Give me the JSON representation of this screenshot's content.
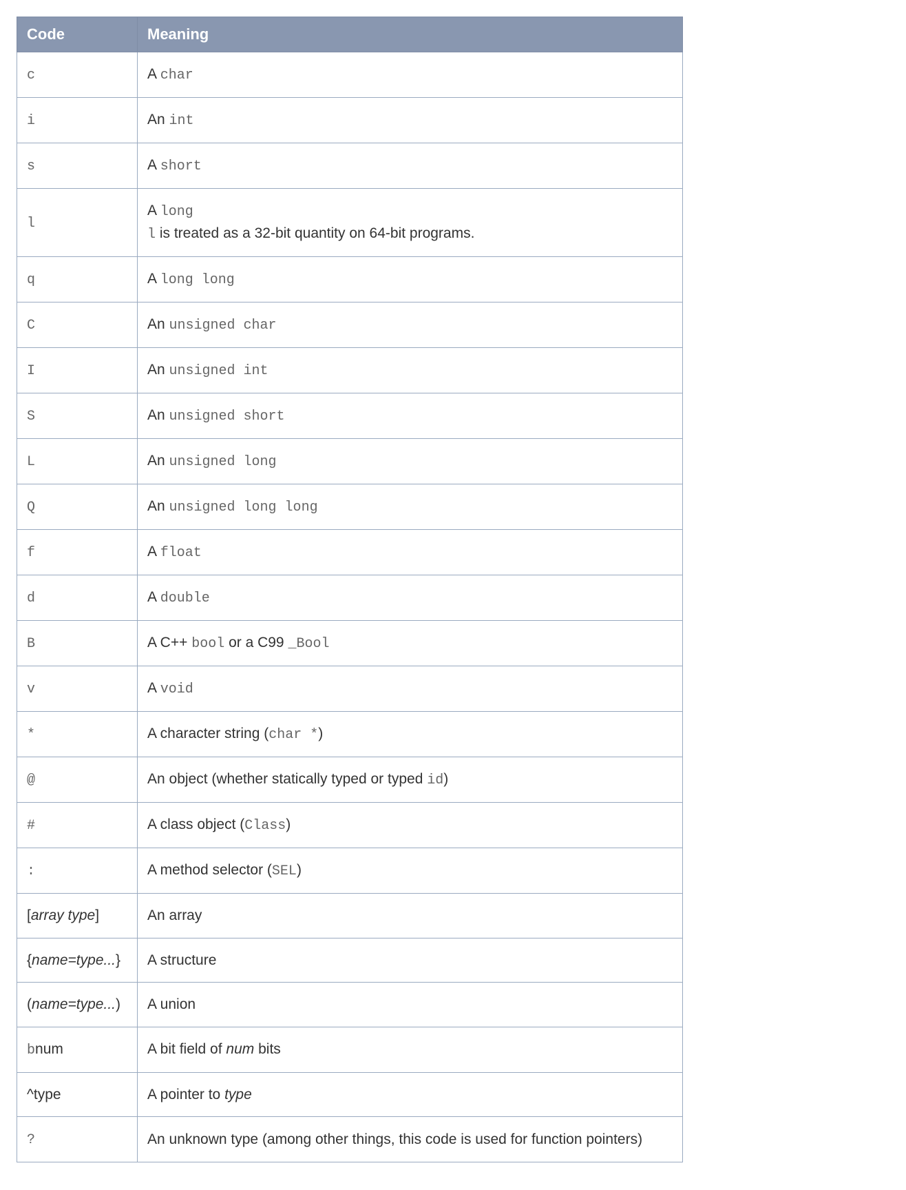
{
  "table": {
    "headers": {
      "code": "Code",
      "meaning": "Meaning"
    },
    "rows": [
      {
        "code": [
          {
            "t": "mono",
            "v": "c"
          }
        ],
        "meaning": [
          {
            "t": "text",
            "v": "A "
          },
          {
            "t": "mono",
            "v": "char"
          }
        ]
      },
      {
        "code": [
          {
            "t": "mono",
            "v": "i"
          }
        ],
        "meaning": [
          {
            "t": "text",
            "v": "An "
          },
          {
            "t": "mono",
            "v": "int"
          }
        ]
      },
      {
        "code": [
          {
            "t": "mono",
            "v": "s"
          }
        ],
        "meaning": [
          {
            "t": "text",
            "v": "A "
          },
          {
            "t": "mono",
            "v": "short"
          }
        ]
      },
      {
        "code": [
          {
            "t": "mono",
            "v": "l"
          }
        ],
        "meaning": [
          {
            "t": "text",
            "v": "A "
          },
          {
            "t": "mono",
            "v": "long"
          },
          {
            "t": "br"
          },
          {
            "t": "mono",
            "v": "l"
          },
          {
            "t": "text",
            "v": " is treated as a 32-bit quantity on 64-bit programs."
          }
        ]
      },
      {
        "code": [
          {
            "t": "mono",
            "v": "q"
          }
        ],
        "meaning": [
          {
            "t": "text",
            "v": "A "
          },
          {
            "t": "mono",
            "v": "long long"
          }
        ]
      },
      {
        "code": [
          {
            "t": "mono",
            "v": "C"
          }
        ],
        "meaning": [
          {
            "t": "text",
            "v": "An "
          },
          {
            "t": "mono",
            "v": "unsigned char"
          }
        ]
      },
      {
        "code": [
          {
            "t": "mono",
            "v": "I"
          }
        ],
        "meaning": [
          {
            "t": "text",
            "v": "An "
          },
          {
            "t": "mono",
            "v": "unsigned int"
          }
        ]
      },
      {
        "code": [
          {
            "t": "mono",
            "v": "S"
          }
        ],
        "meaning": [
          {
            "t": "text",
            "v": "An "
          },
          {
            "t": "mono",
            "v": "unsigned short"
          }
        ]
      },
      {
        "code": [
          {
            "t": "mono",
            "v": "L"
          }
        ],
        "meaning": [
          {
            "t": "text",
            "v": "An "
          },
          {
            "t": "mono",
            "v": "unsigned long"
          }
        ]
      },
      {
        "code": [
          {
            "t": "mono",
            "v": "Q"
          }
        ],
        "meaning": [
          {
            "t": "text",
            "v": "An "
          },
          {
            "t": "mono",
            "v": "unsigned long long"
          }
        ]
      },
      {
        "code": [
          {
            "t": "mono",
            "v": "f"
          }
        ],
        "meaning": [
          {
            "t": "text",
            "v": "A "
          },
          {
            "t": "mono",
            "v": "float"
          }
        ]
      },
      {
        "code": [
          {
            "t": "mono",
            "v": "d"
          }
        ],
        "meaning": [
          {
            "t": "text",
            "v": "A "
          },
          {
            "t": "mono",
            "v": "double"
          }
        ]
      },
      {
        "code": [
          {
            "t": "mono",
            "v": "B"
          }
        ],
        "meaning": [
          {
            "t": "text",
            "v": "A C++ "
          },
          {
            "t": "mono",
            "v": "bool"
          },
          {
            "t": "text",
            "v": " or a C99 "
          },
          {
            "t": "mono",
            "v": "_Bool"
          }
        ]
      },
      {
        "code": [
          {
            "t": "mono",
            "v": "v"
          }
        ],
        "meaning": [
          {
            "t": "text",
            "v": "A "
          },
          {
            "t": "mono",
            "v": "void"
          }
        ]
      },
      {
        "code": [
          {
            "t": "mono",
            "v": "*"
          }
        ],
        "meaning": [
          {
            "t": "text",
            "v": "A character string ("
          },
          {
            "t": "mono",
            "v": "char *"
          },
          {
            "t": "text",
            "v": ")"
          }
        ]
      },
      {
        "code": [
          {
            "t": "mono",
            "v": "@"
          }
        ],
        "meaning": [
          {
            "t": "text",
            "v": "An object (whether statically typed or typed "
          },
          {
            "t": "mono",
            "v": "id"
          },
          {
            "t": "text",
            "v": ")"
          }
        ]
      },
      {
        "code": [
          {
            "t": "mono",
            "v": "#"
          }
        ],
        "meaning": [
          {
            "t": "text",
            "v": "A class object ("
          },
          {
            "t": "mono",
            "v": "Class"
          },
          {
            "t": "text",
            "v": ")"
          }
        ]
      },
      {
        "code": [
          {
            "t": "mono",
            "v": ":"
          }
        ],
        "meaning": [
          {
            "t": "text",
            "v": "A method selector ("
          },
          {
            "t": "mono",
            "v": "SEL"
          },
          {
            "t": "text",
            "v": ")"
          }
        ]
      },
      {
        "code": [
          {
            "t": "text",
            "v": "["
          },
          {
            "t": "italic",
            "v": "array type"
          },
          {
            "t": "text",
            "v": "]"
          }
        ],
        "meaning": [
          {
            "t": "text",
            "v": "An array"
          }
        ]
      },
      {
        "code": [
          {
            "t": "text",
            "v": "{"
          },
          {
            "t": "italic",
            "v": "name=type..."
          },
          {
            "t": "text",
            "v": "}"
          }
        ],
        "meaning": [
          {
            "t": "text",
            "v": "A structure"
          }
        ]
      },
      {
        "code": [
          {
            "t": "text",
            "v": "("
          },
          {
            "t": "italic",
            "v": "name=type..."
          },
          {
            "t": "text",
            "v": ")"
          }
        ],
        "meaning": [
          {
            "t": "text",
            "v": "A union"
          }
        ]
      },
      {
        "code": [
          {
            "t": "mono",
            "v": "b"
          },
          {
            "t": "text",
            "v": "num"
          }
        ],
        "meaning": [
          {
            "t": "text",
            "v": "A bit field of "
          },
          {
            "t": "italic",
            "v": "num"
          },
          {
            "t": "text",
            "v": " bits"
          }
        ]
      },
      {
        "code": [
          {
            "t": "text",
            "v": "^type"
          }
        ],
        "meaning": [
          {
            "t": "text",
            "v": "A pointer to "
          },
          {
            "t": "italic",
            "v": "type"
          }
        ]
      },
      {
        "code": [
          {
            "t": "mono",
            "v": "?"
          }
        ],
        "meaning": [
          {
            "t": "text",
            "v": "An unknown type (among other things, this code is used for function pointers)"
          }
        ]
      }
    ]
  }
}
